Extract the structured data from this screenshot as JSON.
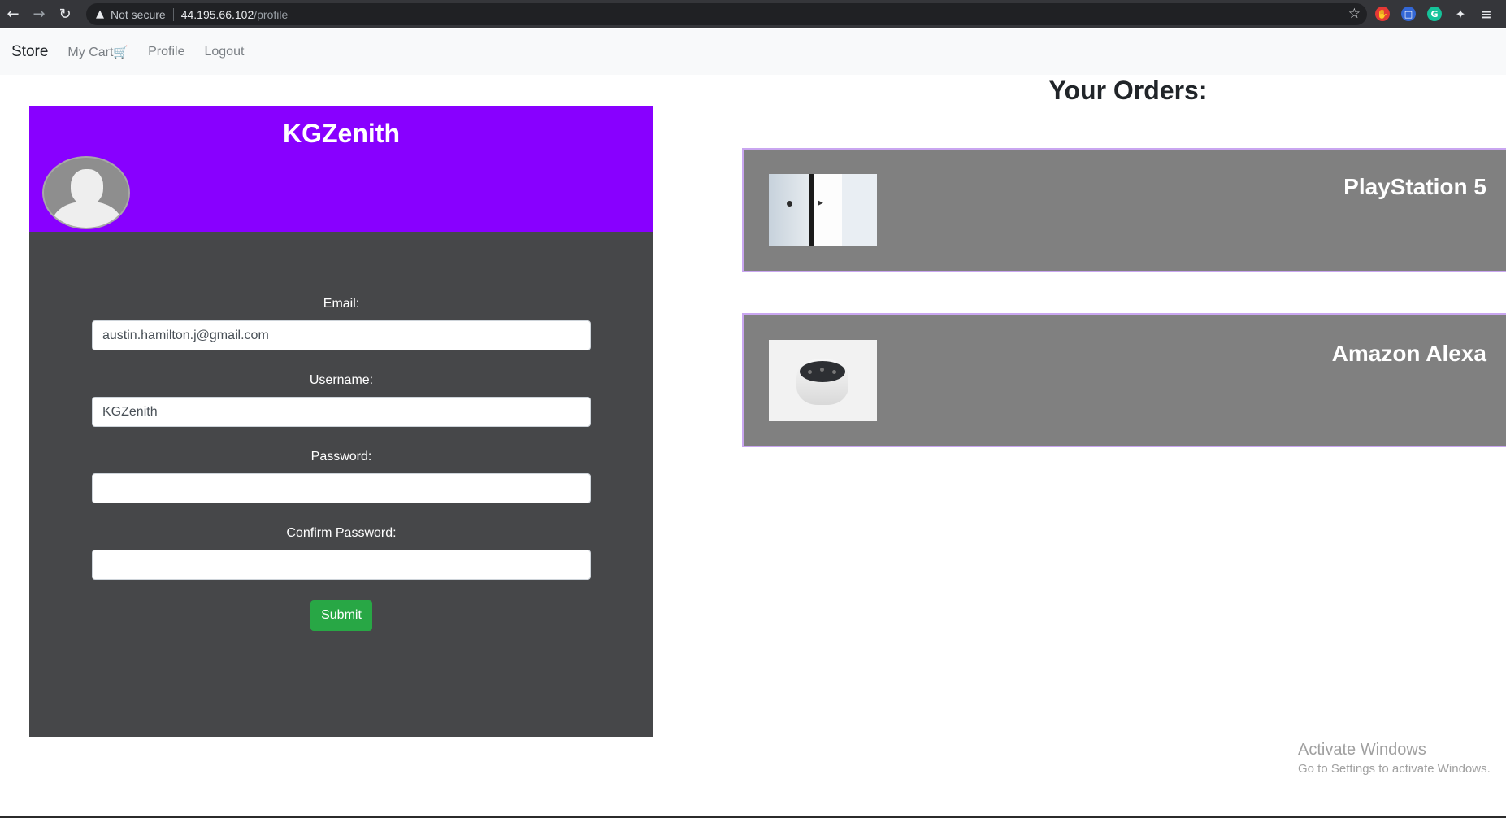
{
  "browser": {
    "back_icon": "arrow-left-icon",
    "forward_icon": "arrow-right-icon",
    "reload_icon": "reload-icon",
    "security_text": "Not secure",
    "url_host": "44.195.66.102",
    "url_path": "/profile"
  },
  "navbar": {
    "brand": "Store",
    "cart_label": "My Cart",
    "profile_label": "Profile",
    "logout_label": "Logout"
  },
  "profile": {
    "username_display": "KGZenith",
    "email_label": "Email:",
    "email_value": "austin.hamilton.j@gmail.com",
    "username_label": "Username:",
    "username_value": "KGZenith",
    "password_label": "Password:",
    "password_value": "",
    "confirm_label": "Confirm Password:",
    "confirm_value": "",
    "submit_label": "Submit",
    "header_color": "#8800ff",
    "submit_color": "#28a745"
  },
  "orders": {
    "title": "Your Orders:",
    "items": [
      {
        "name": "PlayStation 5",
        "image": "playstation-5-photo"
      },
      {
        "name": "Amazon Alexa",
        "image": "amazon-alexa-photo"
      }
    ]
  },
  "watermark": {
    "title": "Activate Windows",
    "subtitle": "Go to Settings to activate Windows."
  }
}
